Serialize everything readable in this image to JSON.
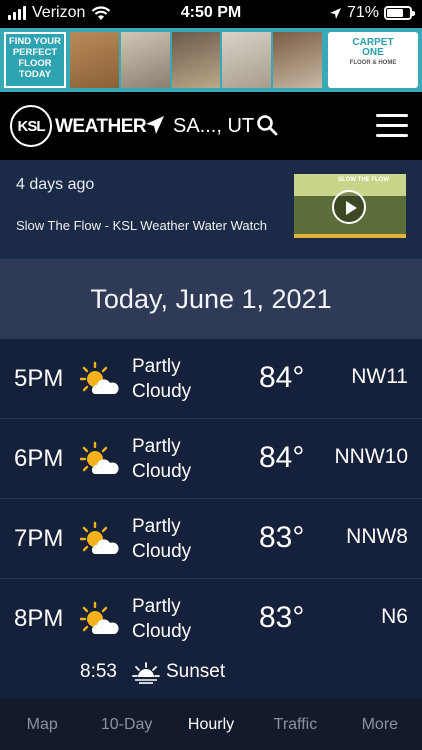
{
  "status_bar": {
    "carrier": "Verizon",
    "time": "4:50 PM",
    "battery": "71%"
  },
  "ad": {
    "left_text": "FIND YOUR PERFECT FLOOR TODAY",
    "brand_line1": "CARPET",
    "brand_line2": "ONE",
    "brand_line3": "FLOOR & HOME"
  },
  "header": {
    "logo_ksl": "KSL",
    "logo_weather": "WEATHER",
    "location": "SA..., UT"
  },
  "news": {
    "age": "4 days ago",
    "headline": "Slow The Flow - KSL Weather Water Watch",
    "thumb_caption": "SLOW THE FLOW"
  },
  "date_heading": "Today, June 1, 2021",
  "forecast": [
    {
      "hour": "5PM",
      "cond_line1": "Partly",
      "cond_line2": "Cloudy",
      "temp": "84°",
      "wind": "NW11",
      "icon": "partly-cloudy-icon"
    },
    {
      "hour": "6PM",
      "cond_line1": "Partly",
      "cond_line2": "Cloudy",
      "temp": "84°",
      "wind": "NNW10",
      "icon": "partly-cloudy-icon"
    },
    {
      "hour": "7PM",
      "cond_line1": "Partly",
      "cond_line2": "Cloudy",
      "temp": "83°",
      "wind": "NNW8",
      "icon": "partly-cloudy-icon"
    },
    {
      "hour": "8PM",
      "cond_line1": "Partly",
      "cond_line2": "Cloudy",
      "temp": "83°",
      "wind": "N6",
      "icon": "partly-cloudy-icon"
    }
  ],
  "sunset": {
    "time": "8:53",
    "label": "Sunset",
    "icon": "sunset-icon"
  },
  "tabs": [
    {
      "label": "Map",
      "active": false
    },
    {
      "label": "10-Day",
      "active": false
    },
    {
      "label": "Hourly",
      "active": true
    },
    {
      "label": "Traffic",
      "active": false
    },
    {
      "label": "More",
      "active": false
    }
  ],
  "colors": {
    "background": "#15203a",
    "header": "#000000",
    "date_band": "#2f3b56",
    "sun": "#f5b21b"
  }
}
